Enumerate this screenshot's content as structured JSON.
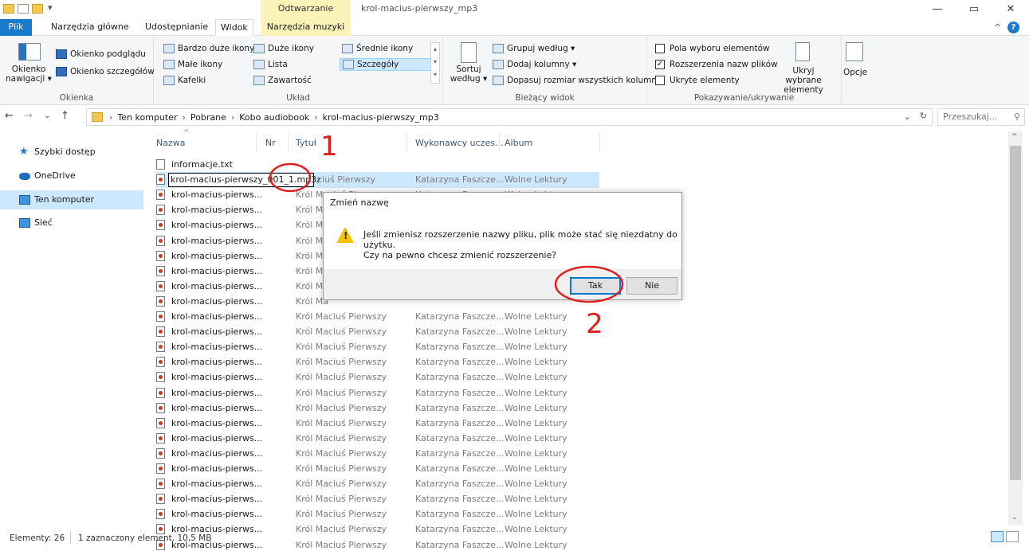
{
  "window": {
    "title": "krol-macius-pierwszy_mp3",
    "context_tab_header": "Odtwarzanie",
    "controls": {
      "minimize": "—",
      "maximize": "▭",
      "close": "✕"
    }
  },
  "ribbon_tabs": [
    "Plik",
    "Narzędzia główne",
    "Udostępnianie",
    "Widok",
    "Narzędzia muzyki"
  ],
  "ribbon": {
    "panes": {
      "label": "Okienka",
      "nav_pane": "Okienko nawigacji ▾",
      "preview_pane": "Okienko podglądu",
      "details_pane": "Okienko szczegółów"
    },
    "layout": {
      "label": "Układ",
      "items": [
        "Bardzo duże ikony",
        "Duże ikony",
        "Średnie ikony",
        "Małe ikony",
        "Lista",
        "Szczegóły",
        "Kafelki",
        "Zawartość"
      ]
    },
    "current_view": {
      "label": "Bieżący widok",
      "sort_by": "Sortuj według ▾",
      "group_by": "Grupuj według ▾",
      "add_columns": "Dodaj kolumny ▾",
      "fit_columns": "Dopasuj rozmiar wszystkich kolumn"
    },
    "show_hide": {
      "label": "Pokazywanie/ukrywanie",
      "item_checkboxes": "Pola wyboru elementów",
      "file_extensions": "Rozszerzenia nazw plików",
      "hidden_items": "Ukryte elementy",
      "hide_selected": "Ukryj wybrane elementy",
      "options": "Opcje"
    }
  },
  "address": {
    "crumbs": [
      "Ten komputer",
      "Pobrane",
      "Kobo audiobook",
      "krol-macius-pierwszy_mp3"
    ],
    "search_placeholder": "Przeszukaj..."
  },
  "nav": [
    "Szybki dostęp",
    "OneDrive",
    "Ten komputer",
    "Sieć"
  ],
  "columns": [
    "Nazwa",
    "Nr",
    "Tytuł",
    "Wykonawcy uczes...",
    "Album"
  ],
  "rename_value": "krol-macius-pierwszy_001_1.mp3z",
  "files": {
    "first": "informacje.txt",
    "name": "krol-macius-pierws...",
    "title": "Król Maciuś Pierwszy",
    "title_partial": "Król Ma",
    "title_sel_partial": "ciuś Pierwszy",
    "artist": "Katarzyna Faszcze...",
    "album": "Wolne Lektury"
  },
  "status": {
    "elements": "Elementy: 26",
    "selected": "1 zaznaczony element. 10,5 MB"
  },
  "dialog": {
    "title": "Zmień nazwę",
    "message": "Jeśli zmienisz rozszerzenie nazwy pliku, plik może stać się niezdatny do użytku.",
    "question": "Czy na pewno chcesz zmienić rozszerzenie?",
    "yes": "Tak",
    "no": "Nie",
    "warning_glyph": "!"
  },
  "annotations": [
    "1",
    "2"
  ],
  "colors": {
    "accent": "#1979ca",
    "selection": "#cce8ff",
    "context_tab": "#fbf3b8",
    "annotation": "#e01e1e"
  }
}
